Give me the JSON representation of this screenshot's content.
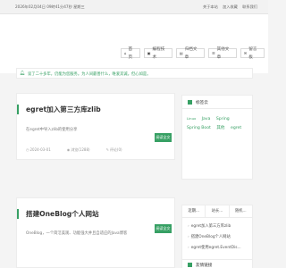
{
  "topbar": {
    "datetime": "2026年02月04日 09時41分47秒 星期三",
    "links": [
      "关于本站",
      "加入收藏",
      "联系我们"
    ]
  },
  "nav": [
    {
      "icon": "home-icon",
      "label": "首页"
    },
    {
      "icon": "code-icon",
      "label": "编程技术"
    },
    {
      "icon": "archive-icon",
      "label": "归档文章"
    },
    {
      "icon": "list-icon",
      "label": "其他文章"
    },
    {
      "icon": "chat-icon",
      "label": "留言板"
    }
  ],
  "notice": {
    "text": "谈了二十多年，仍能为您服务。为人间最善什么，唯爱其诚。但心如是。"
  },
  "posts": [
    {
      "title": "egret加入第三方库zlib",
      "excerpt": "在egret中导入zlib的使用分享",
      "date": "2024-03-01",
      "views": "浏览(1288)",
      "comments": "评论(0)",
      "more": "阅读全文"
    },
    {
      "title": "搭建OneBlog个人网站",
      "excerpt": "OneBlog，一个简洁美观、功能强大并且自适应的Java博客",
      "more": "阅读全文"
    }
  ],
  "tags_widget": {
    "title": "标签云",
    "tags": [
      {
        "text": "Linux",
        "small": true
      },
      {
        "text": "Java",
        "small": false
      },
      {
        "text": "Spring",
        "small": false
      },
      {
        "text": "Spring Boot",
        "small": false
      },
      {
        "text": "其他",
        "small": false
      },
      {
        "text": "egret",
        "small": false
      }
    ]
  },
  "recent_widget": {
    "tabs": [
      "近期...",
      "站长...",
      "随机..."
    ],
    "items": [
      "egret加入第三方库zlib",
      "搭建OneBlog个人网站",
      "egret使用egret.EventDis..."
    ]
  },
  "links_widget": {
    "title": "友情链接"
  },
  "colors": {
    "accent": "#37a064"
  }
}
